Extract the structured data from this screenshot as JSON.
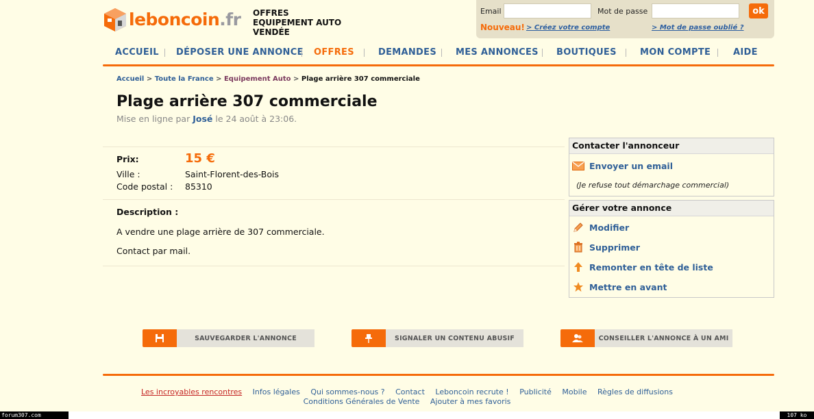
{
  "header": {
    "logo_main": "leboncoin",
    "logo_ext": ".fr",
    "category_lines": [
      "OFFRES",
      "EQUIPEMENT AUTO",
      "VENDÉE"
    ]
  },
  "login": {
    "email_label": "Email",
    "password_label": "Mot de passe",
    "email_value": "",
    "password_value": "",
    "ok_label": "ok",
    "nouveau": "Nouveau!",
    "create_account": "> Créez votre compte",
    "forgot_password": "> Mot de passe oublié ?"
  },
  "nav": {
    "items": [
      {
        "label": "ACCUEIL"
      },
      {
        "label": "DÉPOSER UNE ANNONCE"
      },
      {
        "label": "OFFRES"
      },
      {
        "label": "DEMANDES"
      },
      {
        "label": "MES ANNONCES"
      },
      {
        "label": "BOUTIQUES"
      },
      {
        "label": "MON COMPTE"
      },
      {
        "label": "AIDE"
      }
    ],
    "active_color": "#f56b0a",
    "link_color": "#2f5f97"
  },
  "breadcrumb": {
    "home": "Accueil",
    "region": "Toute la France",
    "category": "Equipement Auto",
    "current": "Plage arrière 307 commerciale",
    "separator": ">"
  },
  "ad": {
    "title": "Plage arrière 307 commerciale",
    "posted_prefix": "Mise en ligne par",
    "author": "José",
    "posted_date": "le 24 août à 23:06.",
    "price_label": "Prix:",
    "price": "15 €",
    "city_label": "Ville :",
    "city": "Saint-Florent-des-Bois",
    "postal_label": "Code postal :",
    "postal": "85310",
    "description_label": "Description :",
    "description": [
      "A vendre une plage arrière de 307 commerciale.",
      "Contact par mail."
    ]
  },
  "contact_panel": {
    "title": "Contacter l'annonceur",
    "email_link": "Envoyer un email",
    "note": "(Je refuse tout démarchage commercial)"
  },
  "manage_panel": {
    "title": "Gérer votre annonce",
    "items": [
      {
        "label": "Modifier",
        "icon": "pencil-icon"
      },
      {
        "label": "Supprimer",
        "icon": "trash-icon"
      },
      {
        "label": "Remonter en tête de liste",
        "icon": "arrow-up-icon"
      },
      {
        "label": "Mettre en avant",
        "icon": "star-icon"
      }
    ]
  },
  "actions": [
    {
      "label": "SAUVEGARDER L'ANNONCE",
      "icon": "save-icon"
    },
    {
      "label": "SIGNALER UN CONTENU ABUSIF",
      "icon": "pin-icon"
    },
    {
      "label": "CONSEILLER L'ANNONCE À UN AMI",
      "icon": "friends-icon"
    }
  ],
  "footer": {
    "line1": [
      "Les incroyables rencontres",
      "Infos légales",
      "Qui sommes-nous ?",
      "Contact",
      "Leboncoin recrute !",
      "Publicité",
      "Mobile",
      "Règles de diffusions"
    ],
    "line2": [
      "Conditions Générales de Vente",
      "Ajouter à mes favoris"
    ]
  },
  "status_strip": {
    "left": "forum307.com",
    "right": "107 ko"
  },
  "colors": {
    "accent": "#f56b0a",
    "link": "#2f5f97",
    "background": "#fffde6"
  }
}
